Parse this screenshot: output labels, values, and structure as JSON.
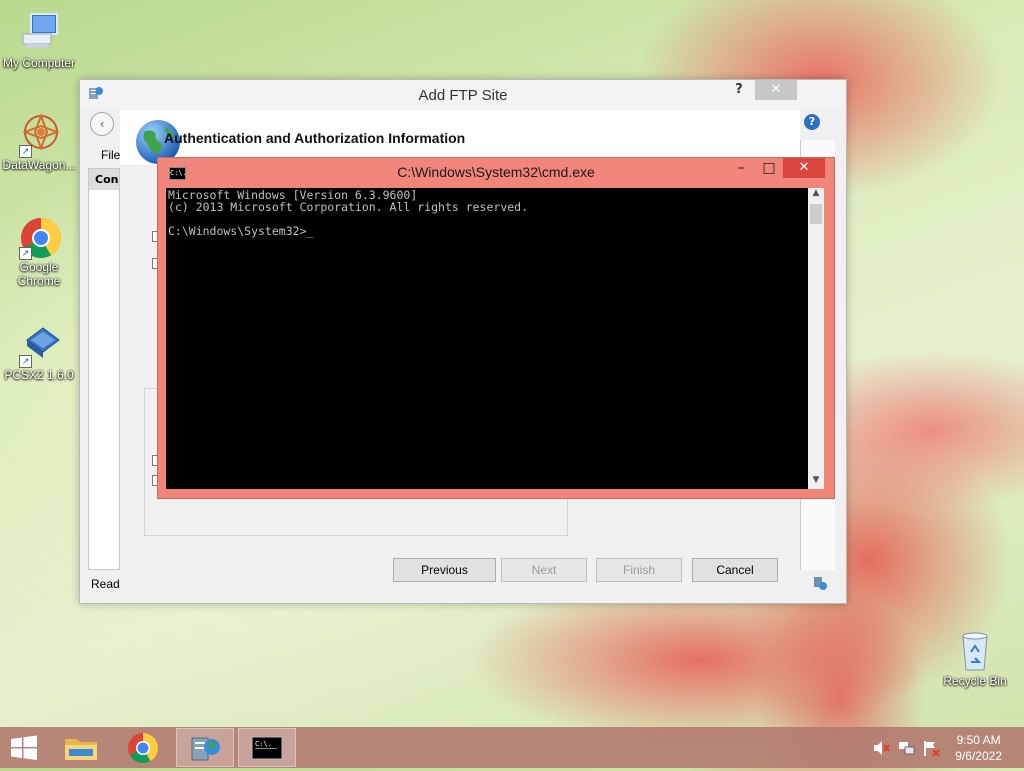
{
  "desktop": {
    "icons": [
      {
        "label": "My Computer",
        "icon": "computer-icon"
      },
      {
        "label": "DataWagon...",
        "icon": "datawagon-icon"
      },
      {
        "label": "Google Chrome",
        "icon": "chrome-icon"
      },
      {
        "label": "PCSX2 1.6.0",
        "icon": "pcsx2-icon"
      },
      {
        "label": "Recycle Bin",
        "icon": "recycle-bin-icon"
      }
    ]
  },
  "ftp_dialog": {
    "title": "Add FTP Site",
    "help": "?",
    "close": "✕",
    "header_title": "Authentication and Authorization Information",
    "background_menu": "File",
    "background_pane_header": "Conn",
    "status": "Read",
    "buttons": {
      "previous": "Previous",
      "next": "Next",
      "finish": "Finish",
      "cancel": "Cancel"
    }
  },
  "cmd_window": {
    "title": "C:\\Windows\\System32\\cmd.exe",
    "icon_text": "C:\\.",
    "lines": [
      "Microsoft Windows [Version 6.3.9600]",
      "(c) 2013 Microsoft Corporation. All rights reserved.",
      "",
      "C:\\Windows\\System32>_"
    ],
    "minimize": "–",
    "maximize": "□",
    "close": "✕"
  },
  "taskbar": {
    "items": [
      "start-icon",
      "file-explorer-icon",
      "chrome-icon",
      "iis-manager-icon",
      "cmd-icon"
    ],
    "time": "9:50 AM",
    "date": "9/6/2022"
  }
}
